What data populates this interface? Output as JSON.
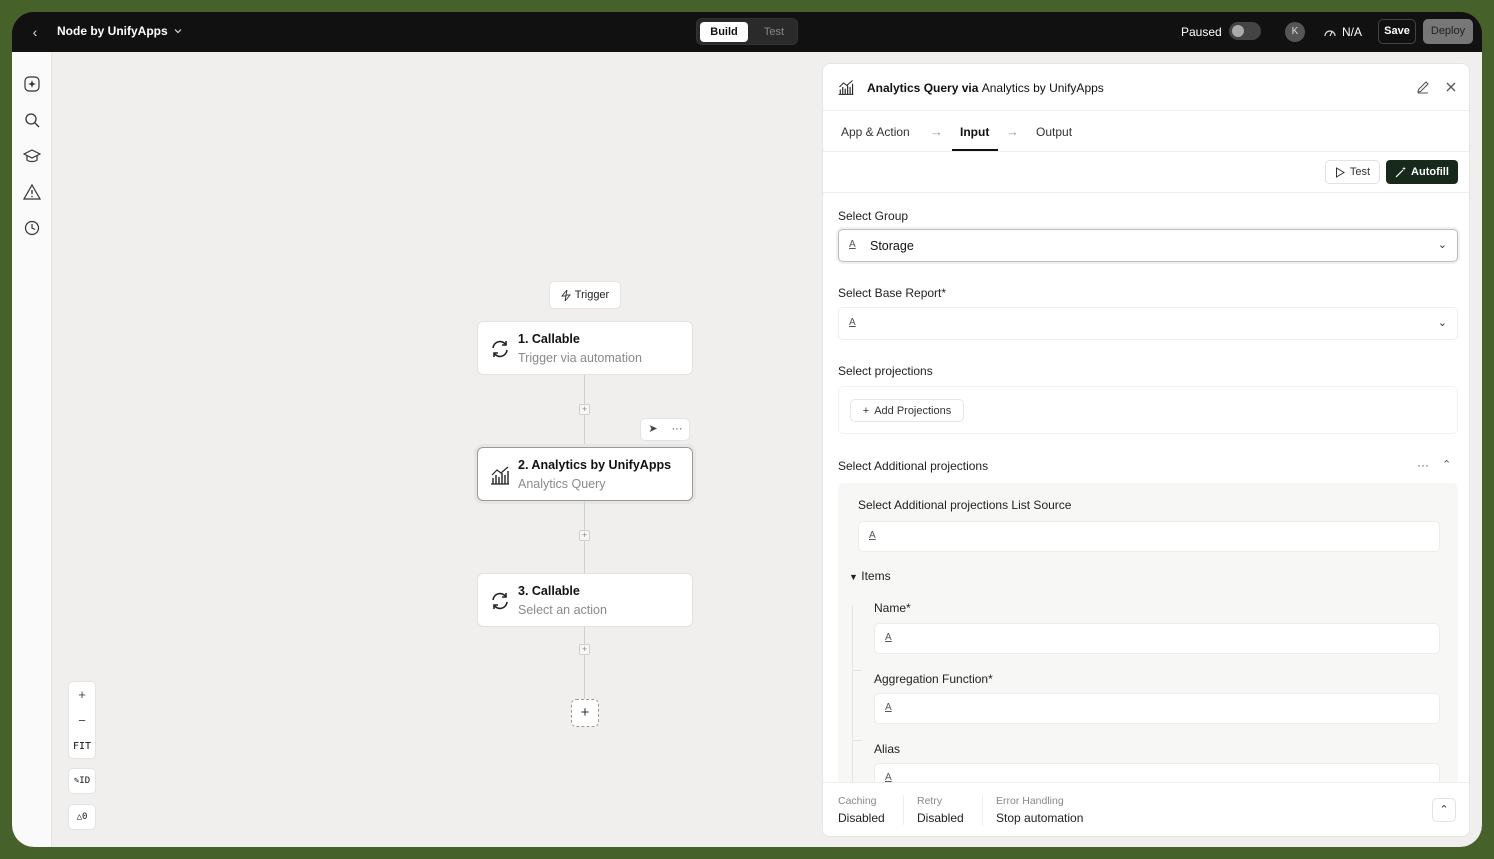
{
  "topbar": {
    "app_name": "Node by UnifyApps",
    "mode_build": "Build",
    "mode_test": "Test",
    "paused_label": "Paused",
    "avatar_initial": "K",
    "status": "N/A",
    "save_label": "Save",
    "deploy_label": "Deploy"
  },
  "canvas": {
    "trigger_label": "Trigger",
    "nodes": [
      {
        "title": "1. Callable",
        "subtitle": "Trigger via automation"
      },
      {
        "title": "2. Analytics by UnifyApps",
        "subtitle": "Analytics Query"
      },
      {
        "title": "3. Callable",
        "subtitle": "Select an action"
      }
    ],
    "zoom": {
      "in": "+",
      "out": "−",
      "fit": "FIT"
    },
    "id_toggle": "ID",
    "warning_count": "0"
  },
  "panel": {
    "title_bold": "Analytics Query via",
    "title_app": "Analytics by UnifyApps",
    "tabs": [
      "App & Action",
      "Input",
      "Output"
    ],
    "active_tab": "Input",
    "test_label": "Test",
    "autofill_label": "Autofill",
    "fields": {
      "select_group_label": "Select Group",
      "select_group_value": "Storage",
      "base_report_label": "Select Base Report*",
      "projections_label": "Select projections",
      "add_projections_label": "Add Projections",
      "additional_label": "Select Additional projections",
      "list_source_label": "Select Additional projections List Source",
      "items_label": "Items",
      "name_label": "Name*",
      "aggregation_label": "Aggregation Function*",
      "alias_label": "Alias"
    },
    "footer": {
      "caching_key": "Caching",
      "caching_val": "Disabled",
      "retry_key": "Retry",
      "retry_val": "Disabled",
      "error_key": "Error Handling",
      "error_val": "Stop automation"
    }
  }
}
